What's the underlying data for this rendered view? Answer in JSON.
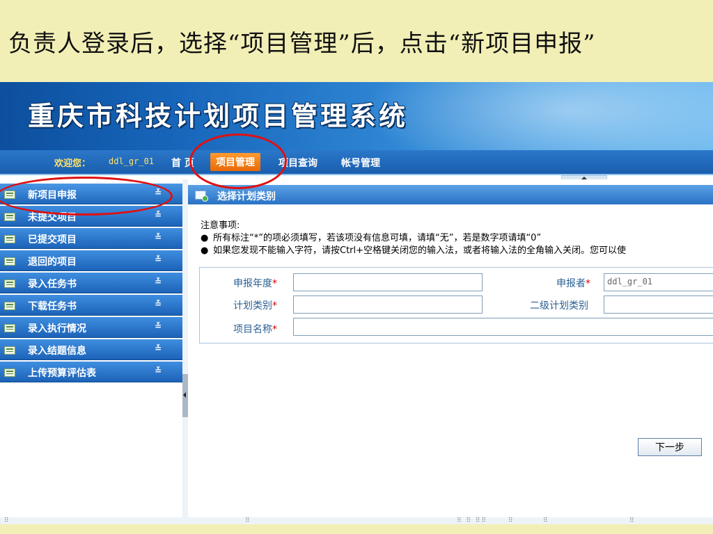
{
  "caption": {
    "text": "负责人登录后，选择“项目管理”后，点击“新项目申报”"
  },
  "app": {
    "title": "重庆市科技计划项目管理系统",
    "welcome_label": "欢迎您：",
    "username": "ddl_gr_01",
    "nav": [
      {
        "label": "首 页"
      },
      {
        "label": "项目管理"
      },
      {
        "label": "项目查询"
      },
      {
        "label": "帐号管理"
      }
    ],
    "active_nav": "项目管理"
  },
  "sidebar": {
    "items": [
      {
        "label": "新项目申报"
      },
      {
        "label": "未提交项目"
      },
      {
        "label": "已提交项目"
      },
      {
        "label": "退回的项目"
      },
      {
        "label": "录入任务书"
      },
      {
        "label": "下载任务书"
      },
      {
        "label": "录入执行情况"
      },
      {
        "label": "录入结题信息"
      },
      {
        "label": "上传预算评估表"
      }
    ],
    "chevron": "≚"
  },
  "main": {
    "panel_title": "选择计划类别",
    "notice_title": "注意事项:",
    "notices": [
      "所有标注“*”的项必须填写，若该项没有信息可填，请填“无”，若是数字项请填“0”",
      "如果您发现不能输入字符，请按Ctrl+空格键关闭您的输入法，或者将输入法的全角输入关闭。您可以使"
    ],
    "bullet": "●",
    "required_mark": "*",
    "form": {
      "year_label": "申报年度",
      "year_value": "",
      "applicant_label": "申报者",
      "applicant_value": "ddl_gr_01",
      "plan_type_label": "计划类别",
      "plan_type_value": "",
      "sub_plan_label": "二级计划类别",
      "sub_plan_value": "",
      "project_name_label": "项目名称",
      "project_name_value": ""
    },
    "next_button": "下一步"
  },
  "colors": {
    "annotation_ring": "#e01010",
    "nav_active": "#e86a08",
    "sidebar_blue": "#1c63b8",
    "slide_background": "#f2efb6"
  }
}
